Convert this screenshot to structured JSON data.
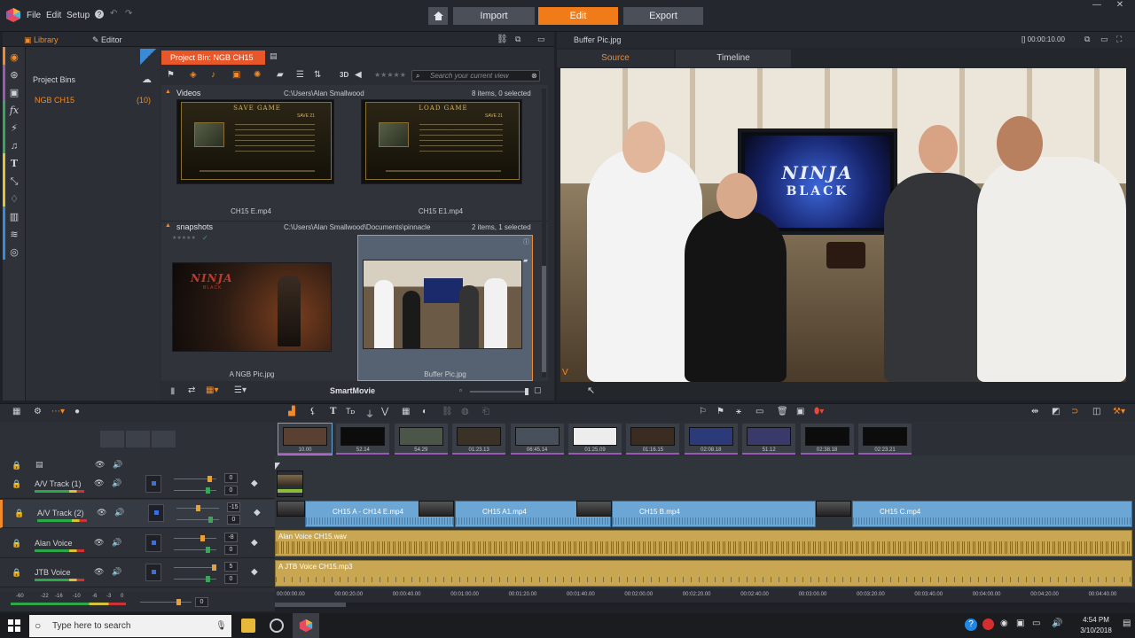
{
  "menubar": {
    "items": [
      "File",
      "Edit",
      "Setup"
    ]
  },
  "modes": {
    "import": "Import",
    "edit": "Edit",
    "export": "Export"
  },
  "library": {
    "tabs": {
      "library": "Library",
      "editor": "Editor"
    },
    "project_bins_title": "Project Bins",
    "bins": [
      {
        "name": "NGB CH15",
        "count": "(10)"
      }
    ],
    "active_bin_tab": "Project Bin: NGB CH15",
    "toolbar": {
      "threeD": "3D",
      "search_placeholder": "Search your current view"
    },
    "sections": [
      {
        "name": "Videos",
        "path": "C:\\Users\\Alan Smallwood",
        "status": "8 items, 0 selected",
        "items": [
          {
            "label": "CH15 E.mp4",
            "screen_title": "SAVE GAME",
            "slot": "SAVE 21"
          },
          {
            "label": "CH15 E1.mp4",
            "screen_title": "LOAD GAME",
            "slot": "SAVE 21"
          }
        ]
      },
      {
        "name": "snapshots",
        "path": "C:\\Users\\Alan Smallwood\\Documents\\pinnacle",
        "status": "2 items, 1 selected",
        "items": [
          {
            "label": "A NGB Pic.jpg",
            "art_text": "NINJA",
            "art_sub": "BLACK"
          },
          {
            "label": "Buffer Pic.jpg"
          }
        ]
      }
    ],
    "footer": {
      "smartmovie": "SmartMovie"
    }
  },
  "player": {
    "file": "Buffer Pic.jpg",
    "timecode": "[] 00:00:10.00",
    "tabs": {
      "source": "Source",
      "timeline": "Timeline"
    },
    "tv_text": "NINJA",
    "tv_sub": "BLACK",
    "corner_marker": "V"
  },
  "storyboard": {
    "clips": [
      "10.00",
      "52.14",
      "54.29",
      "01:23.13",
      "06:45.14",
      "01:25.09",
      "01:16.15",
      "02:08.18",
      "51.12",
      "02:38.18",
      "02:23.21"
    ]
  },
  "tracks": [
    {
      "name": "A/V Track (1)",
      "vol": "0",
      "pan": "0"
    },
    {
      "name": "A/V Track (2)",
      "vol": "-15",
      "pan": "0"
    },
    {
      "name": "Alan Voice",
      "vol": "-8",
      "pan": "0"
    },
    {
      "name": "JTB Voice",
      "vol": "5",
      "pan": "0"
    }
  ],
  "video_clips": [
    {
      "label": "CH15 A - CH14 E.mp4"
    },
    {
      "label": "CH15 A1.mp4"
    },
    {
      "label": "CH15 B.mp4"
    },
    {
      "label": "CH15 C.mp4"
    }
  ],
  "audio_clips": [
    {
      "label": "Alan Voice CH15.wav"
    },
    {
      "label": "A JTB Voice CH15.mp3"
    }
  ],
  "ruler": [
    "00:00:00.00",
    "00:00:20.00",
    "00:00:40.00",
    "00:01:00.00",
    "00:01:20.00",
    "00:01:40.00",
    "00:02:00.00",
    "00:02:20.00",
    "00:02:40.00",
    "00:03:00.00",
    "00:03:20.00",
    "00:03:40.00",
    "00:04:00.00",
    "00:04:20.00",
    "00:04:40.00"
  ],
  "master": {
    "scale": [
      "-60",
      "-22",
      "-16",
      "-10",
      "-6",
      "-3",
      "0"
    ],
    "value": "0"
  },
  "taskbar": {
    "search_placeholder": "Type here to search",
    "time": "4:54 PM",
    "date": "3/10/2018"
  },
  "colors": {
    "accent": "#f07b18",
    "bin_tab": "#e8572a",
    "video_clip": "#6ba6d4",
    "audio_clip": "#c9a652"
  }
}
